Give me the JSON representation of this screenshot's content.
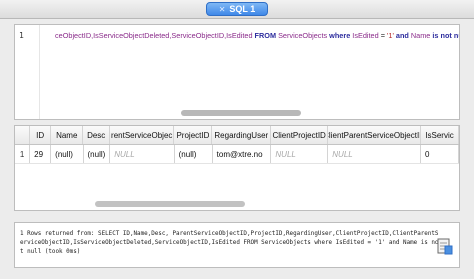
{
  "tab": {
    "title": "SQL 1"
  },
  "editor": {
    "line_number": "1",
    "tokens": [
      {
        "t": "ceObjectID,IsServiceObjectDeleted,ServiceObjectID,IsEdited",
        "c": "id"
      },
      {
        "t": " FROM ",
        "c": "kw"
      },
      {
        "t": "ServiceObjects",
        "c": "id"
      },
      {
        "t": " where ",
        "c": "kw"
      },
      {
        "t": "IsEdited",
        "c": "id"
      },
      {
        "t": " = ",
        "c": "plain"
      },
      {
        "t": "'1'",
        "c": "str"
      },
      {
        "t": " and ",
        "c": "kw"
      },
      {
        "t": "Name",
        "c": "id"
      },
      {
        "t": " is not null",
        "c": "kw"
      }
    ]
  },
  "grid": {
    "columns": [
      "",
      "ID",
      "Name",
      "Desc",
      "rentServiceObjec",
      "ProjectID",
      "RegardingUser",
      "ClientProjectID",
      "ClientParentServiceObjectID",
      "IsServic"
    ],
    "rows": [
      [
        "1",
        "29",
        "(null)",
        "(null)",
        "NULL",
        "(null)",
        "tom@xtre.no",
        "NULL",
        "NULL",
        "0"
      ]
    ]
  },
  "message": {
    "text": "1 Rows returned from: SELECT ID,Name,Desc, ParentServiceObjectID,ProjectID,RegardingUser,ClientProjectID,ClientParentServiceObjectID,IsServiceObjectDeleted,ServiceObjectID,IsEdited FROM ServiceObjects where IsEdited = '1' and Name is not null (took 0ms)"
  },
  "colors": {
    "tab_accent": "#3f88e8",
    "keyword": "#2d2d9e",
    "identifier": "#8a2b8a",
    "string": "#b22222"
  },
  "icons": {
    "tab_close": "close-icon",
    "message_action": "document-export-icon"
  }
}
